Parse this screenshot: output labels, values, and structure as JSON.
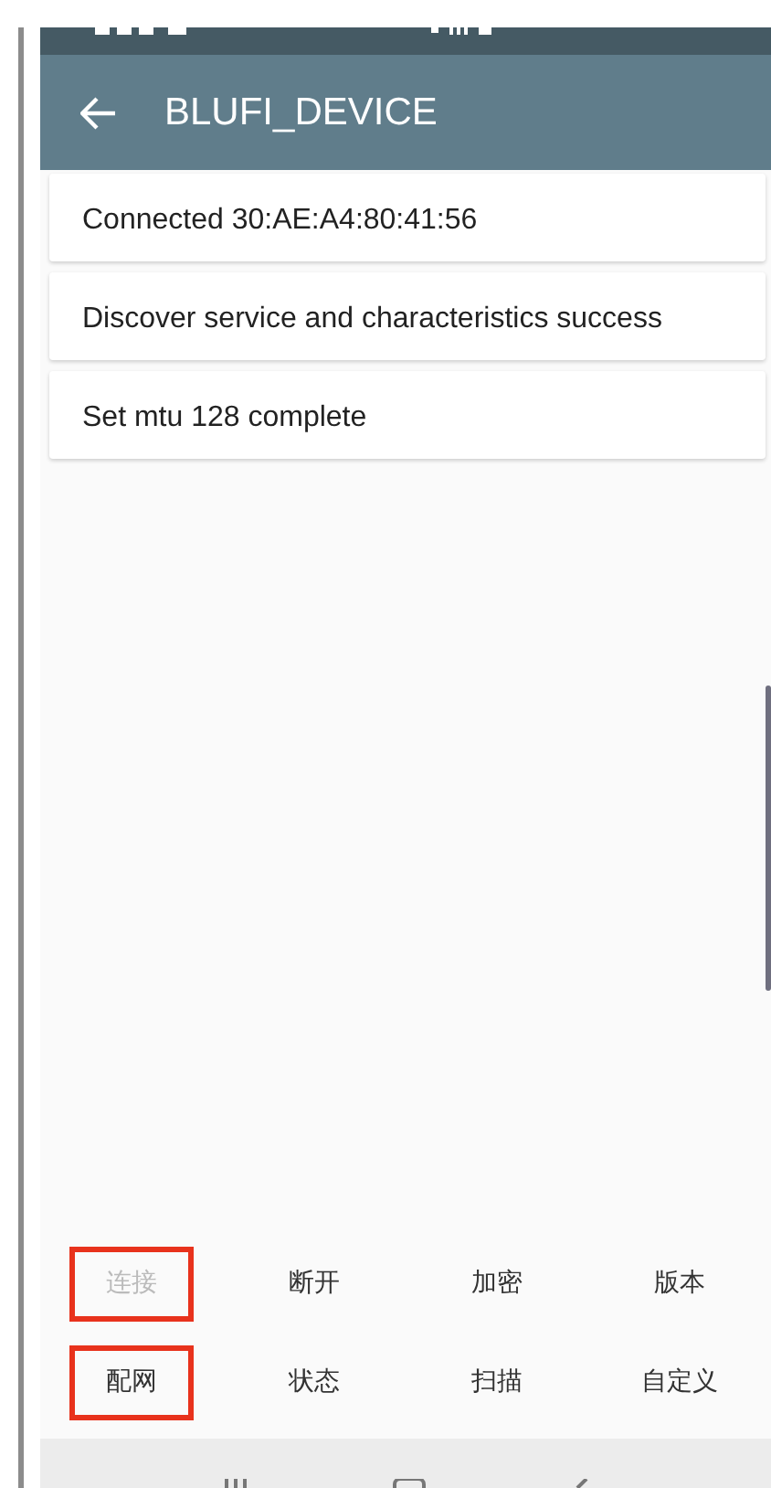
{
  "app_bar": {
    "title": "BLUFI_DEVICE"
  },
  "messages": [
    {
      "text": "Connected 30:AE:A4:80:41:56"
    },
    {
      "text": "Discover service and characteristics success"
    },
    {
      "text": "Set mtu 128 complete"
    }
  ],
  "buttons": [
    {
      "label": "连接",
      "disabled": true,
      "highlighted": true
    },
    {
      "label": "断开",
      "disabled": false,
      "highlighted": false
    },
    {
      "label": "加密",
      "disabled": false,
      "highlighted": false
    },
    {
      "label": "版本",
      "disabled": false,
      "highlighted": false
    },
    {
      "label": "配网",
      "disabled": false,
      "highlighted": true
    },
    {
      "label": "状态",
      "disabled": false,
      "highlighted": false
    },
    {
      "label": "扫描",
      "disabled": false,
      "highlighted": false
    },
    {
      "label": "自定义",
      "disabled": false,
      "highlighted": false
    }
  ]
}
